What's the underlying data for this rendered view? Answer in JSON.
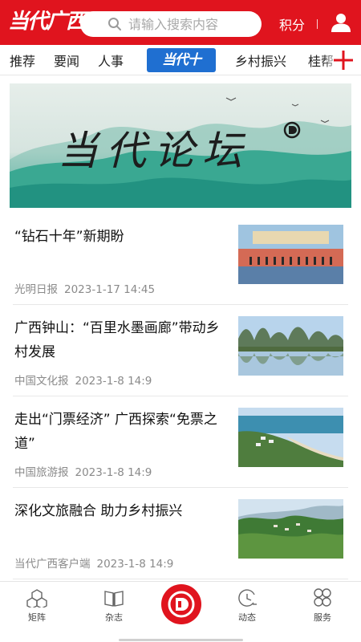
{
  "header": {
    "logo_text": "当代广西",
    "search_placeholder": "请输入搜索内容",
    "points_label": "积分"
  },
  "channels": {
    "items": [
      "推荐",
      "要闻",
      "人事"
    ],
    "featured": "当代十",
    "more": [
      "乡村振兴",
      "桂帮"
    ]
  },
  "banner": {
    "title": "当代论坛"
  },
  "news": [
    {
      "title": "“钻石十年”新期盼",
      "source": "光明日报",
      "time": "2023-1-17 14:45"
    },
    {
      "title": "广西钟山：“百里水墨画廊”带动乡村发展",
      "source": "中国文化报",
      "time": "2023-1-8 14:9"
    },
    {
      "title": "走出“门票经济” 广西探索“免票之道”",
      "source": "中国旅游报",
      "time": "2023-1-8 14:9"
    },
    {
      "title": "深化文旅融合 助力乡村振兴",
      "source": "当代广西客户端",
      "time": "2023-1-8 14:9"
    }
  ],
  "tabbar": {
    "items": [
      {
        "label": "矩阵",
        "icon": "hexagons-icon"
      },
      {
        "label": "杂志",
        "icon": "book-icon"
      },
      {
        "label": "",
        "icon": "center-logo-icon"
      },
      {
        "label": "动态",
        "icon": "clock-icon"
      },
      {
        "label": "服务",
        "icon": "grid-icon"
      }
    ]
  },
  "colors": {
    "brand_red": "#e0141e",
    "featured_blue": "#1f6fd1",
    "banner_teal": "#2a9d8a",
    "meta_gray": "#8a8a8a"
  }
}
